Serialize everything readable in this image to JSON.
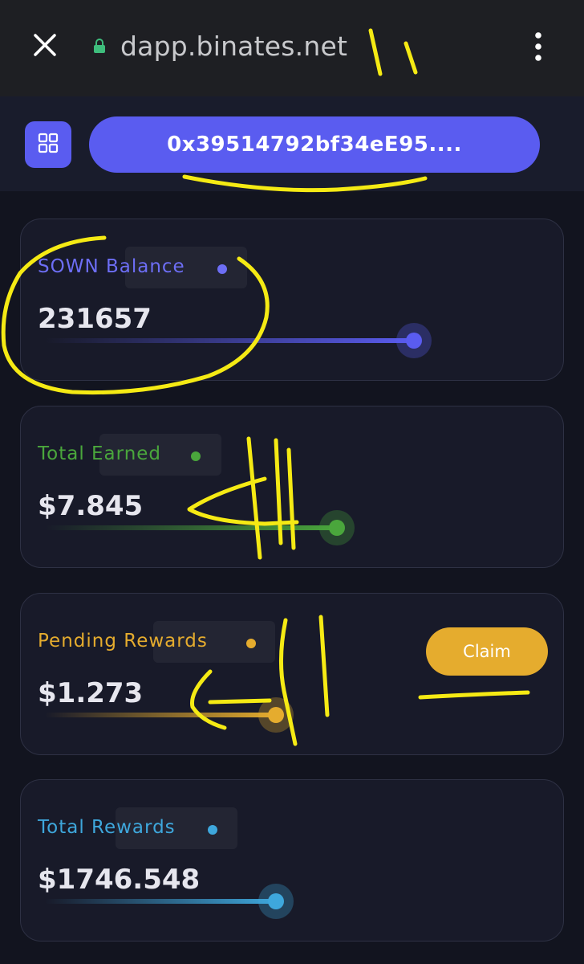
{
  "browser": {
    "url": "dapp.binates.net",
    "icons": {
      "close": "close-icon",
      "lock": "lock-icon",
      "menu": "more-vert-icon"
    }
  },
  "header": {
    "wallet_address": "0x39514792bf34eE95....",
    "grid_icon": "grid-icon"
  },
  "cards": [
    {
      "label": "SOWN Balance",
      "value": "231657",
      "color": "#6d6ef5"
    },
    {
      "label": "Total Earned",
      "value": "$7.845",
      "color": "#4aa63c"
    },
    {
      "label": "Pending Rewards",
      "value": "$1.273",
      "color": "#e5ac2e",
      "action_label": "Claim"
    },
    {
      "label": "Total Rewards",
      "value": "$1746.548",
      "color": "#3ea7dc"
    }
  ],
  "colors": {
    "accent": "#5a5cf0",
    "claim": "#e5ac2e",
    "annotation": "#f5ea14"
  }
}
